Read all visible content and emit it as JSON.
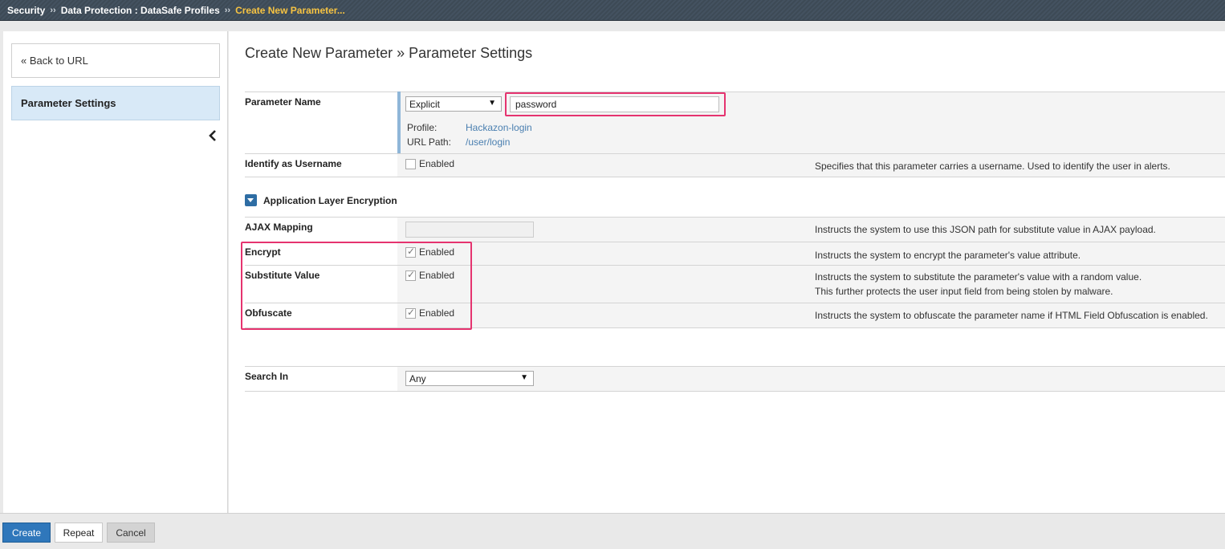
{
  "breadcrumb": {
    "items": [
      "Security",
      "Data Protection : DataSafe Profiles"
    ],
    "separator": "››",
    "current": "Create New Parameter..."
  },
  "sidebar": {
    "back_label": "« Back to URL",
    "active_item": "Parameter Settings"
  },
  "page": {
    "title": "Create New Parameter » Parameter Settings"
  },
  "param_name": {
    "label": "Parameter Name",
    "type_selected": "Explicit",
    "value": "password",
    "profile_label": "Profile:",
    "profile_value": "Hackazon-login",
    "url_label": "URL Path:",
    "url_value": "/user/login"
  },
  "identify_username": {
    "label": "Identify as Username",
    "checkbox_label": "Enabled",
    "checked": false,
    "description": "Specifies that this parameter carries a username. Used to identify the user in alerts."
  },
  "ale_section": {
    "title": "Application Layer Encryption"
  },
  "ajax_mapping": {
    "label": "AJAX Mapping",
    "value": "",
    "description": "Instructs the system to use this JSON path for substitute value in AJAX payload."
  },
  "encrypt": {
    "label": "Encrypt",
    "checkbox_label": "Enabled",
    "checked": true,
    "description": "Instructs the system to encrypt the parameter's value attribute."
  },
  "substitute": {
    "label": "Substitute Value",
    "checkbox_label": "Enabled",
    "checked": true,
    "description_1": "Instructs the system to substitute the parameter's value with a random value.",
    "description_2": "This further protects the user input field from being stolen by malware."
  },
  "obfuscate": {
    "label": "Obfuscate",
    "checkbox_label": "Enabled",
    "checked": true,
    "description": "Instructs the system to obfuscate the parameter name if HTML Field Obfuscation is enabled."
  },
  "search_in": {
    "label": "Search In",
    "selected": "Any"
  },
  "footer": {
    "create_label": "Create",
    "repeat_label": "Repeat",
    "cancel_label": "Cancel"
  },
  "colors": {
    "accent": "#2f77bb",
    "highlight": "#e5336f",
    "breadcrumb_current": "#f6c342",
    "topbar": "#3d4a56"
  }
}
